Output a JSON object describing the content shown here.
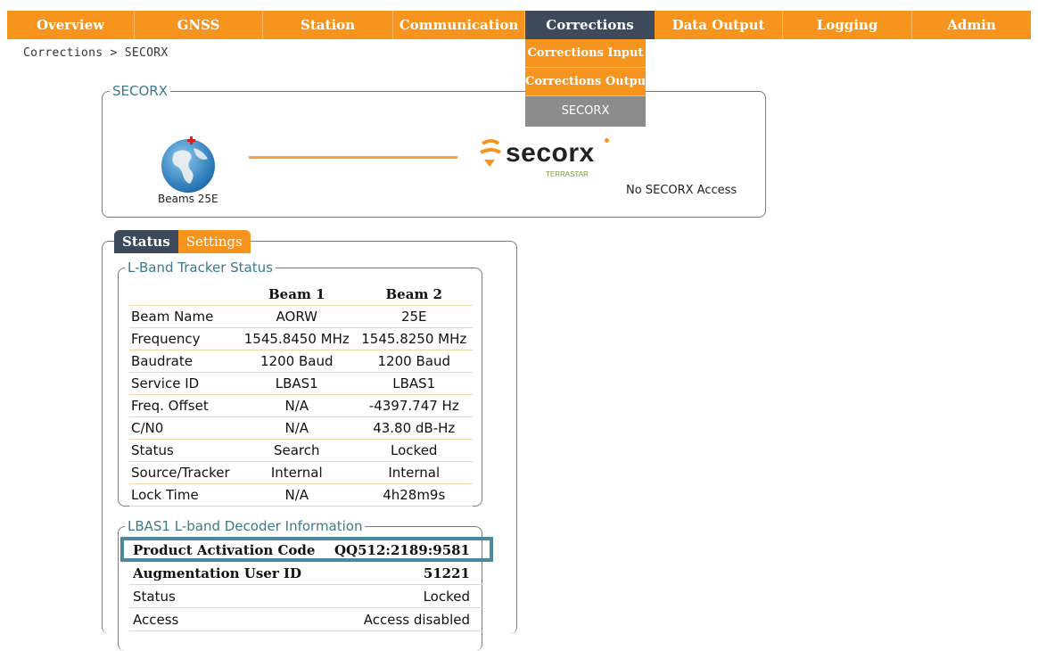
{
  "nav": {
    "items": [
      {
        "label": "Overview",
        "width": 143
      },
      {
        "label": "GNSS",
        "width": 144
      },
      {
        "label": "Station",
        "width": 146
      },
      {
        "label": "Communication",
        "width": 148
      },
      {
        "label": "Corrections",
        "width": 145
      },
      {
        "label": "Data Output",
        "width": 144
      },
      {
        "label": "Logging",
        "width": 145
      },
      {
        "label": "Admin",
        "width": 133
      }
    ],
    "active": "Corrections"
  },
  "dropdown": {
    "items": [
      "Corrections Input",
      "Corrections Output",
      "SECORX"
    ],
    "selected": "SECORX"
  },
  "breadcrumb": "Corrections > SECORX",
  "secorx_panel": {
    "legend": "SECORX",
    "beam_label": "Beams 25E",
    "logo_text": "secorx",
    "logo_sub": "TERRASTAR",
    "access_status": "No SECORX Access"
  },
  "tabs": [
    "Status",
    "Settings"
  ],
  "tracker": {
    "legend": "L-Band Tracker Status",
    "columns": [
      "Beam 1",
      "Beam 2"
    ],
    "rows": [
      {
        "label": "Beam Name",
        "b1": "AORW",
        "b2": "25E"
      },
      {
        "label": "Frequency",
        "b1": "1545.8450 MHz",
        "b2": "1545.8250 MHz"
      },
      {
        "label": "Baudrate",
        "b1": "1200 Baud",
        "b2": "1200 Baud"
      },
      {
        "label": "Service ID",
        "b1": "LBAS1",
        "b2": "LBAS1"
      },
      {
        "label": "Freq. Offset",
        "b1": "N/A",
        "b2": "-4397.747 Hz"
      },
      {
        "label": "C/N0",
        "b1": "N/A",
        "b2": "43.80 dB-Hz"
      },
      {
        "label": "Status",
        "b1": "Search",
        "b2": "Locked"
      },
      {
        "label": "Source/Tracker",
        "b1": "Internal",
        "b2": "Internal"
      },
      {
        "label": "Lock Time",
        "b1": "N/A",
        "b2": "4h28m9s"
      }
    ]
  },
  "decoder": {
    "legend": "LBAS1 L-band Decoder Information",
    "rows": [
      {
        "label": "Product Activation Code",
        "value": "QQ512:2189:9581",
        "bold": true
      },
      {
        "label": "Augmentation User ID",
        "value": "51221",
        "bold": true
      },
      {
        "label": "Status",
        "value": "Locked",
        "bold": false
      },
      {
        "label": "Access",
        "value": "Access disabled",
        "bold": false
      }
    ]
  },
  "colors": {
    "accent": "#f7941d",
    "active_nav": "#3d4a5c",
    "legend": "#3a7a8c",
    "highlight": "#4a8a9c"
  }
}
